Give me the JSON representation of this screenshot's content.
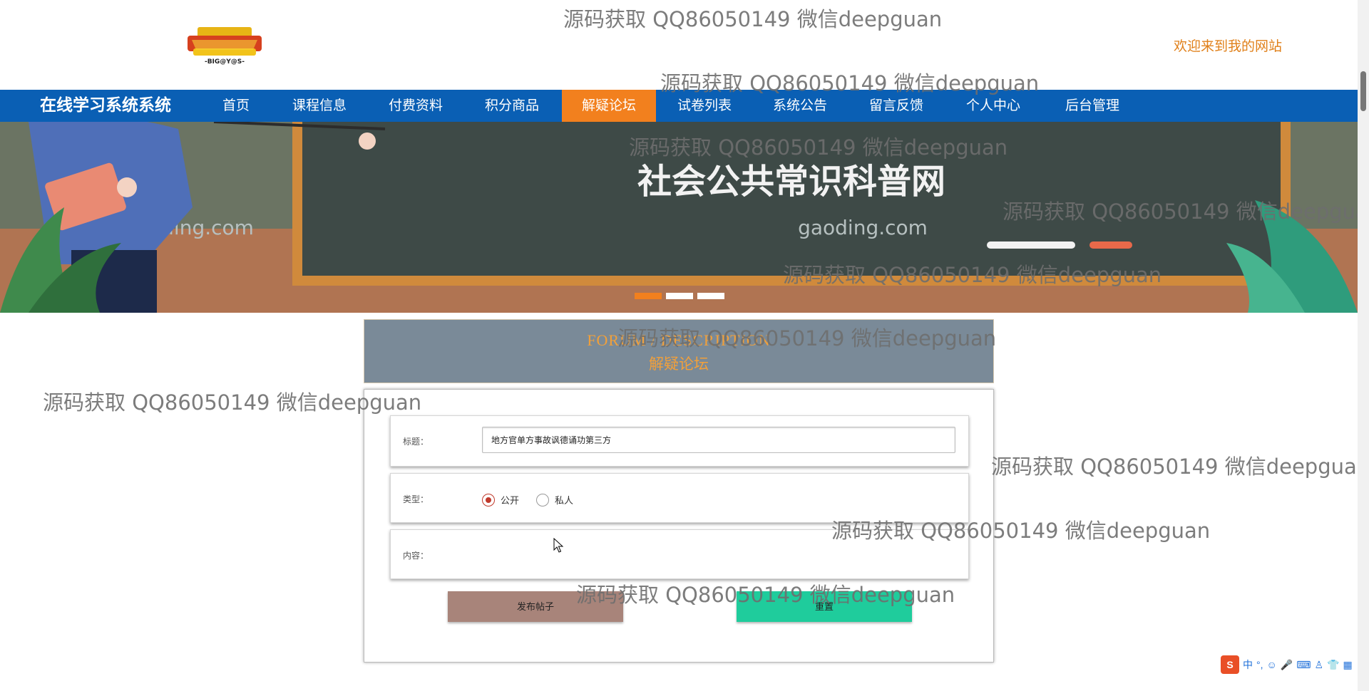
{
  "header": {
    "logo_alt": "BIG@Y@S",
    "welcome_text": "欢迎来到我的网站"
  },
  "nav": {
    "brand": "在线学习系统系统",
    "items": [
      "首页",
      "课程信息",
      "付费资料",
      "积分商品",
      "解疑论坛",
      "试卷列表",
      "系统公告",
      "留言反馈",
      "个人中心",
      "后台管理"
    ],
    "active_index": 4
  },
  "banner": {
    "headline": "社会公共常识科普网",
    "watermark_left": "gaoding.com",
    "watermark_right": "gaoding.com",
    "slides": 3,
    "active_slide": 0
  },
  "section": {
    "title_en": "FORUM / DESCRIPTION",
    "title_cn": "解疑论坛"
  },
  "form": {
    "title_label": "标题：",
    "title_value": "地方官单方事故讽德诵功第三方",
    "type_label": "类型：",
    "type_options": [
      "公开",
      "私人"
    ],
    "type_selected": 0,
    "content_label": "内容：",
    "submit_label": "发布帖子",
    "reset_label": "重置"
  },
  "watermark": "源码获取 QQ86050149 微信deepguan",
  "ime_toolbar": {
    "logo": "S",
    "mode": "中"
  },
  "colors": {
    "nav_bg": "#0a5fb4",
    "nav_active": "#f2801e",
    "welcome": "#e0801a",
    "section_bg": "#7a8a98",
    "submit_bg": "#a8847a",
    "reset_bg": "#1fcc9c"
  }
}
